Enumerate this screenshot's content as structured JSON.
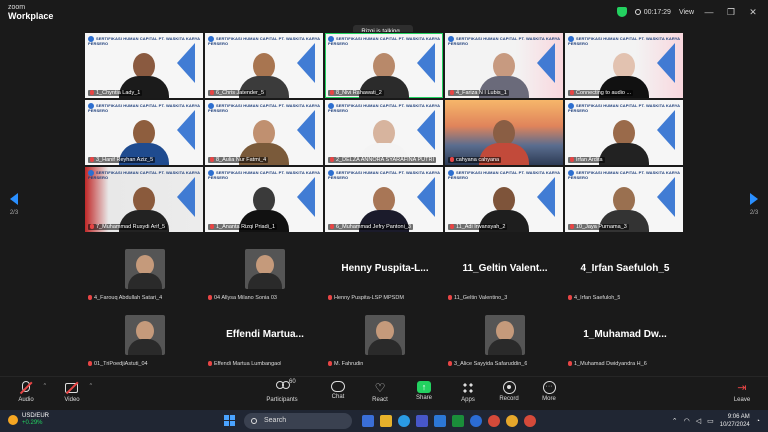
{
  "titlebar": {
    "brand_line1": "zoom",
    "brand_line2": "Workplace",
    "timer": "00:17:29",
    "view_label": "View",
    "minimize": "—",
    "maximize": "❐",
    "close": "✕"
  },
  "talking_banner": "Rizqi is talking...",
  "pagination": {
    "left": "2/3",
    "right": "2/3"
  },
  "video_tiles": [
    {
      "name": "1_Chyntia Lady_1",
      "style": "dark",
      "skin": "#8a5a40",
      "shirt": "#1b1b1b"
    },
    {
      "name": "6_Chris Jatender_5",
      "style": "dark",
      "skin": "#a87550",
      "shirt": "#3b3b3b"
    },
    {
      "name": "8_Nivi Rahawati_2",
      "style": "dark",
      "skin": "#b8896a",
      "shirt": "#2b2b2b",
      "active": true
    },
    {
      "name": "4_Fariza N I Lubis_1",
      "style": "pink",
      "skin": "#c79a80",
      "shirt": "#6a6a7a"
    },
    {
      "name": "Connecting to audio ...",
      "style": "pink",
      "skin": "#e2c2b0",
      "shirt": "#111"
    },
    {
      "name": "3_Hanif Reyhan Aziz_5",
      "style": "dark",
      "skin": "#8e5e3e",
      "shirt": "#1f4b8f"
    },
    {
      "name": "8_Aulia Nur Fatmi_4",
      "style": "dark",
      "skin": "#c09070",
      "shirt": "#7a5a3a"
    },
    {
      "name": "2_DELZA ANNORA SYARAFINA PUTRI",
      "style": "dark",
      "skin": "#d7b49e",
      "shirt": "#f4f4f4"
    },
    {
      "name": "cahyana cahyana",
      "style": "sunset",
      "skin": "#8a5e44",
      "shirt": "#c24a3a"
    },
    {
      "name": "Irfan Ardita",
      "style": "dark",
      "skin": "#9a6a4a",
      "shirt": "#222"
    },
    {
      "name": "7_Muhammad Rusydi Arif_5",
      "style": "red",
      "skin": "#8a5a3c",
      "shirt": "#222"
    },
    {
      "name": "1_Ananta Rizqi Priadi_1",
      "style": "dark",
      "skin": "#3a3a3a",
      "shirt": "#111"
    },
    {
      "name": "6_Muhammad Jefry Pantoni_3",
      "style": "dark",
      "skin": "#a87656",
      "shirt": "#1b1b2b"
    },
    {
      "name": "11_Adi Irwansyah_2",
      "style": "dark",
      "skin": "#7e543a",
      "shirt": "#1e1e1e"
    },
    {
      "name": "10_Jaya Purnama_3",
      "style": "dark",
      "skin": "#9a7050",
      "shirt": "#333"
    }
  ],
  "tile_banner": "SERTIFIKASI HUMAN CAPITAL PT. WASKITA KARYA PERSERO",
  "participants": [
    {
      "display": "4_Farouq Abdullah Satari_4",
      "avatar": true,
      "big": ""
    },
    {
      "display": "04 Allysa Milano Sonia 03",
      "avatar": true,
      "big": ""
    },
    {
      "display": "Henny Puspita-LSP MPSDM",
      "avatar": false,
      "big": "Henny  Puspita-L..."
    },
    {
      "display": "11_Geltin Valentino_3",
      "avatar": false,
      "big": "11_Geltin  Valent..."
    },
    {
      "display": "4_Irfan Saefuloh_5",
      "avatar": false,
      "big": "4_Irfan  Saefuloh_5"
    },
    {
      "display": "01_TriPoedjiAstuti_04",
      "avatar": true,
      "big": ""
    },
    {
      "display": "Effendi Martua Lumbangaol",
      "avatar": false,
      "big": "Effendi  Martua..."
    },
    {
      "display": "M. Fahrudin",
      "avatar": true,
      "big": ""
    },
    {
      "display": "3_Alice Sayyida Safaruddin_6",
      "avatar": true,
      "big": ""
    },
    {
      "display": "1_Muhamad Dwidyandra H_6",
      "avatar": false,
      "big": "1_Muhamad  Dw..."
    }
  ],
  "toolbar": {
    "audio": "Audio",
    "video": "Video",
    "participants": "Participants",
    "participants_count": "60",
    "chat": "Chat",
    "react": "React",
    "share": "Share",
    "apps": "Apps",
    "record": "Record",
    "more": "More",
    "leave": "Leave"
  },
  "taskbar": {
    "currency": "USD/EUR",
    "change": "+0.29%",
    "search_placeholder": "Search",
    "time": "9:06 AM",
    "date": "10/27/2024"
  },
  "colors": {
    "accent_blue": "#2d6fd0",
    "share_green": "#23d160",
    "mute_red": "#e84545"
  }
}
